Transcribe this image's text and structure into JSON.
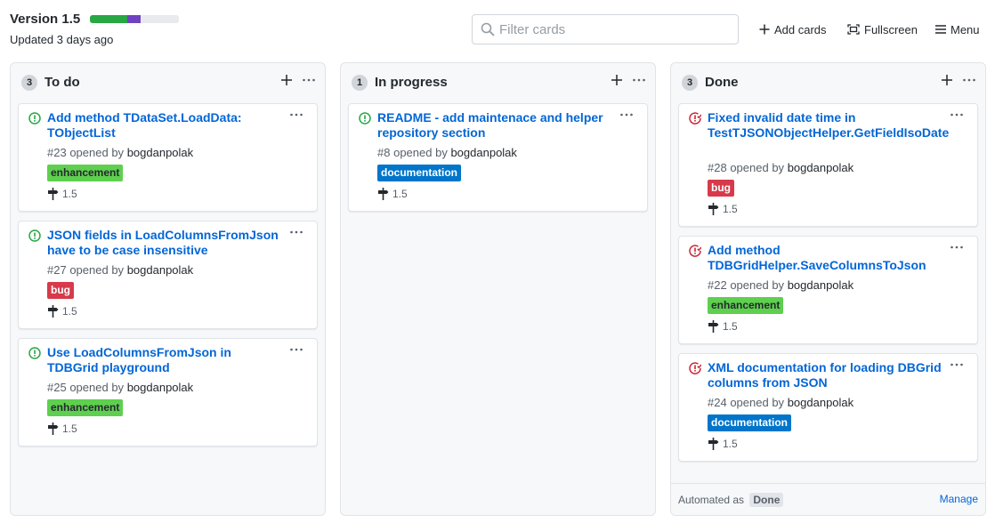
{
  "project": {
    "title": "Version 1.5",
    "updated": "Updated 3 days ago",
    "progress": [
      {
        "status": "done",
        "fraction": 0.42,
        "color": "#28a745"
      },
      {
        "status": "in_progress",
        "fraction": 0.15,
        "color": "#6f42c1"
      },
      {
        "status": "todo",
        "fraction": 0.43,
        "color": "#e8eaed"
      }
    ]
  },
  "filter": {
    "placeholder": "Filter cards",
    "value": ""
  },
  "header_buttons": {
    "add_cards": "Add cards",
    "fullscreen": "Fullscreen",
    "menu": "Menu"
  },
  "columns": [
    {
      "count": "3",
      "title": "To do",
      "cards": [
        {
          "title": "Add method TDataSet.LoadData: TObjectList",
          "state": "open",
          "number": "#23",
          "opened_by": "opened by",
          "author": "bogdanpolak",
          "label": "enhancement",
          "label_bg": "#5ecf4e",
          "label_fg": "#24292e",
          "milestone": "1.5"
        },
        {
          "title": "JSON fields in LoadColumnsFromJson have to be case insensitive",
          "state": "open",
          "number": "#27",
          "opened_by": "opened by",
          "author": "bogdanpolak",
          "label": "bug",
          "label_bg": "#d73a4a",
          "label_fg": "#ffffff",
          "milestone": "1.5"
        },
        {
          "title": "Use LoadColumnsFromJson in TDBGrid playground",
          "state": "open",
          "number": "#25",
          "opened_by": "opened by",
          "author": "bogdanpolak",
          "label": "enhancement",
          "label_bg": "#5ecf4e",
          "label_fg": "#24292e",
          "milestone": "1.5"
        }
      ]
    },
    {
      "count": "1",
      "title": "In progress",
      "cards": [
        {
          "title": "README - add maintenace and helper repository section",
          "state": "open",
          "number": "#8",
          "opened_by": "opened by",
          "author": "bogdanpolak",
          "label": "documentation",
          "label_bg": "#0075ca",
          "label_fg": "#ffffff",
          "milestone": "1.5"
        }
      ]
    },
    {
      "count": "3",
      "title": "Done",
      "cards": [
        {
          "title": "Fixed invalid date time in TestTJSONObjectHelper.GetFieldIsoDate",
          "state": "closed",
          "number": "#28",
          "opened_by": "opened by",
          "author": "bogdanpolak",
          "label": "bug",
          "label_bg": "#d73a4a",
          "label_fg": "#ffffff",
          "milestone": "1.5"
        },
        {
          "title": "Add method TDBGridHelper.SaveColumnsToJson",
          "state": "closed",
          "number": "#22",
          "opened_by": "opened by",
          "author": "bogdanpolak",
          "label": "enhancement",
          "label_bg": "#5ecf4e",
          "label_fg": "#24292e",
          "milestone": "1.5"
        },
        {
          "title": "XML documentation for loading DBGrid columns from JSON",
          "state": "closed",
          "number": "#24",
          "opened_by": "opened by",
          "author": "bogdanpolak",
          "label": "documentation",
          "label_bg": "#0075ca",
          "label_fg": "#ffffff",
          "milestone": "1.5"
        }
      ],
      "automation": {
        "prefix": "Automated as",
        "badge": "Done",
        "manage": "Manage"
      }
    }
  ],
  "icons": {
    "open_issue": "issue-opened-icon",
    "closed_issue": "issue-closed-icon",
    "milestone": "milestone-icon",
    "more": "kebab-icon",
    "add": "plus-icon",
    "search": "search-icon",
    "fullscreen": "screen-full-icon",
    "menu": "hamburger-icon"
  }
}
